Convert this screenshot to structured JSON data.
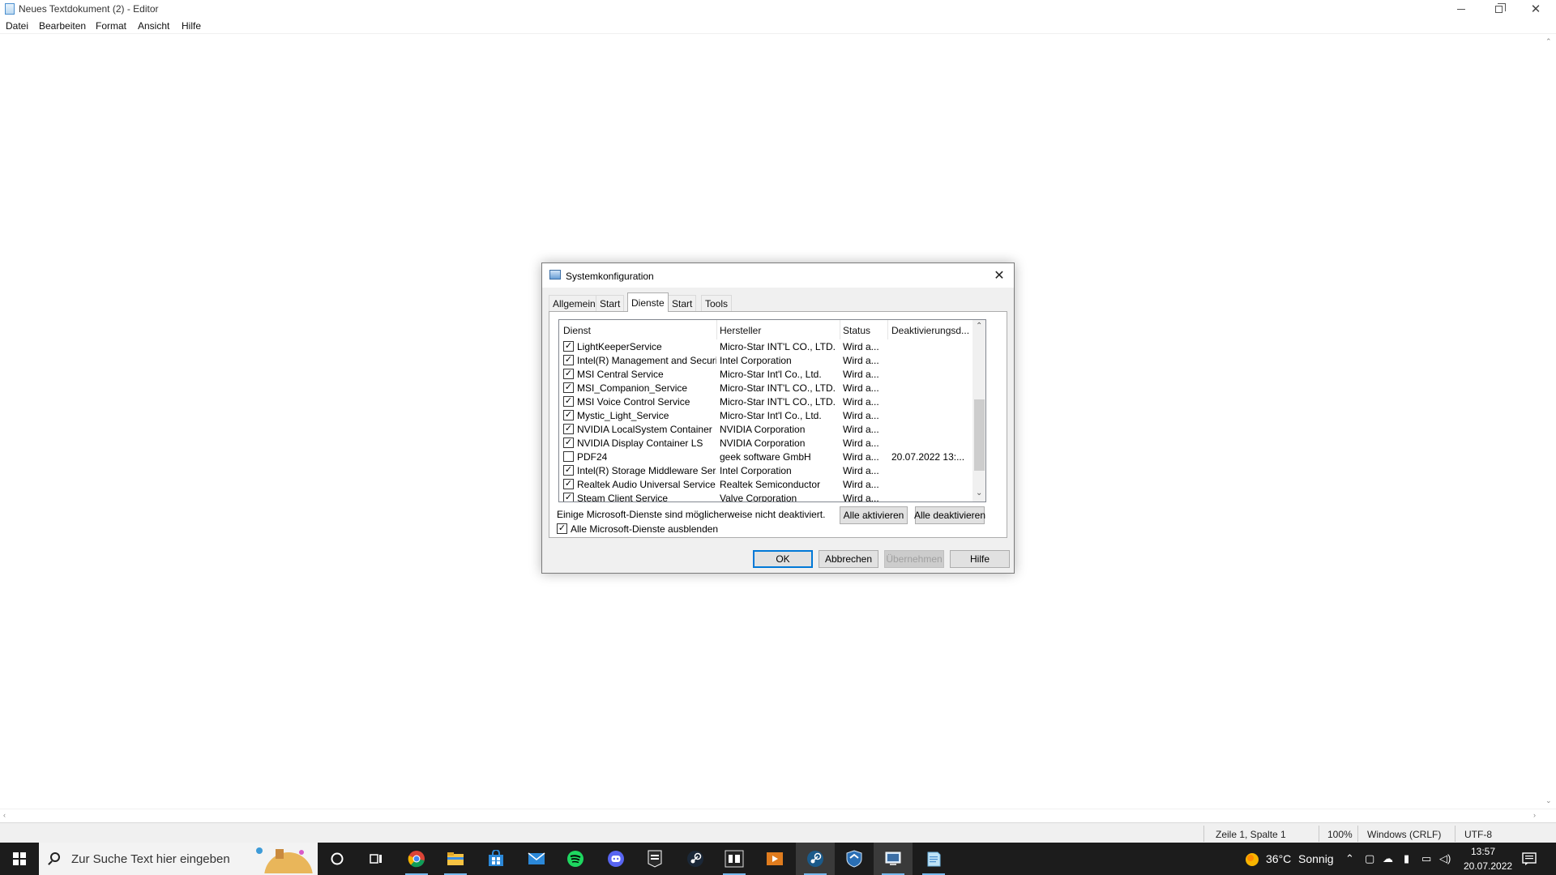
{
  "notepad": {
    "title": "Neues Textdokument (2) - Editor",
    "menu": [
      "Datei",
      "Bearbeiten",
      "Format",
      "Ansicht",
      "Hilfe"
    ],
    "status": {
      "position": "Zeile 1, Spalte 1",
      "zoom": "100%",
      "line_ending": "Windows (CRLF)",
      "encoding": "UTF-8"
    }
  },
  "dialog": {
    "title": "Systemkonfiguration",
    "tabs": [
      "Allgemein",
      "Start",
      "Dienste",
      "Start",
      "Tools"
    ],
    "active_tab": "Dienste",
    "columns": [
      "Dienst",
      "Hersteller",
      "Status",
      "Deaktivierungsd..."
    ],
    "rows": [
      {
        "checked": true,
        "name": "LightKeeperService",
        "maker": "Micro-Star INT'L CO., LTD.",
        "status": "Wird a...",
        "date": ""
      },
      {
        "checked": true,
        "name": "Intel(R) Management and Securi...",
        "maker": "Intel Corporation",
        "status": "Wird a...",
        "date": ""
      },
      {
        "checked": true,
        "name": "MSI Central Service",
        "maker": "Micro-Star Int'l Co., Ltd.",
        "status": "Wird a...",
        "date": ""
      },
      {
        "checked": true,
        "name": "MSI_Companion_Service",
        "maker": "Micro-Star INT'L CO., LTD.",
        "status": "Wird a...",
        "date": ""
      },
      {
        "checked": true,
        "name": "MSI Voice Control Service",
        "maker": "Micro-Star INT'L CO., LTD.",
        "status": "Wird a...",
        "date": ""
      },
      {
        "checked": true,
        "name": "Mystic_Light_Service",
        "maker": "Micro-Star Int'l Co., Ltd.",
        "status": "Wird a...",
        "date": ""
      },
      {
        "checked": true,
        "name": "NVIDIA LocalSystem Container",
        "maker": "NVIDIA Corporation",
        "status": "Wird a...",
        "date": ""
      },
      {
        "checked": true,
        "name": "NVIDIA Display Container LS",
        "maker": "NVIDIA Corporation",
        "status": "Wird a...",
        "date": ""
      },
      {
        "checked": false,
        "name": "PDF24",
        "maker": "geek software GmbH",
        "status": "Wird a...",
        "date": "20.07.2022 13:..."
      },
      {
        "checked": true,
        "name": "Intel(R) Storage Middleware Ser...",
        "maker": "Intel Corporation",
        "status": "Wird a...",
        "date": ""
      },
      {
        "checked": true,
        "name": "Realtek Audio Universal Service",
        "maker": "Realtek Semiconductor",
        "status": "Wird a...",
        "date": ""
      },
      {
        "checked": true,
        "name": "Steam Client Service",
        "maker": "Valve Corporation",
        "status": "Wird a...",
        "date": ""
      }
    ],
    "info_text": "Einige Microsoft-Dienste sind möglicherweise nicht deaktiviert.",
    "enable_all": "Alle aktivieren",
    "disable_all": "Alle deaktivieren",
    "hide_ms_label": "Alle Microsoft-Dienste ausblenden",
    "hide_ms_checked": true,
    "ok": "OK",
    "cancel": "Abbrechen",
    "apply": "Übernehmen",
    "help": "Hilfe"
  },
  "taskbar": {
    "search_placeholder": "Zur Suche Text hier eingeben",
    "weather_temp": "36°C",
    "weather_desc": "Sonnig",
    "time": "13:57",
    "date": "20.07.2022",
    "apps": [
      "cortana-icon",
      "task-view-icon",
      "chrome-icon",
      "file-explorer-icon",
      "store-icon",
      "mail-icon",
      "spotify-icon",
      "discord-icon",
      "epic-games-icon",
      "steam-icon",
      "bm-app-icon",
      "media-player-icon",
      "steam-active-icon",
      "shield-app-icon",
      "msconfig-icon",
      "notepad-icon"
    ],
    "accent": "#76b9ed"
  }
}
